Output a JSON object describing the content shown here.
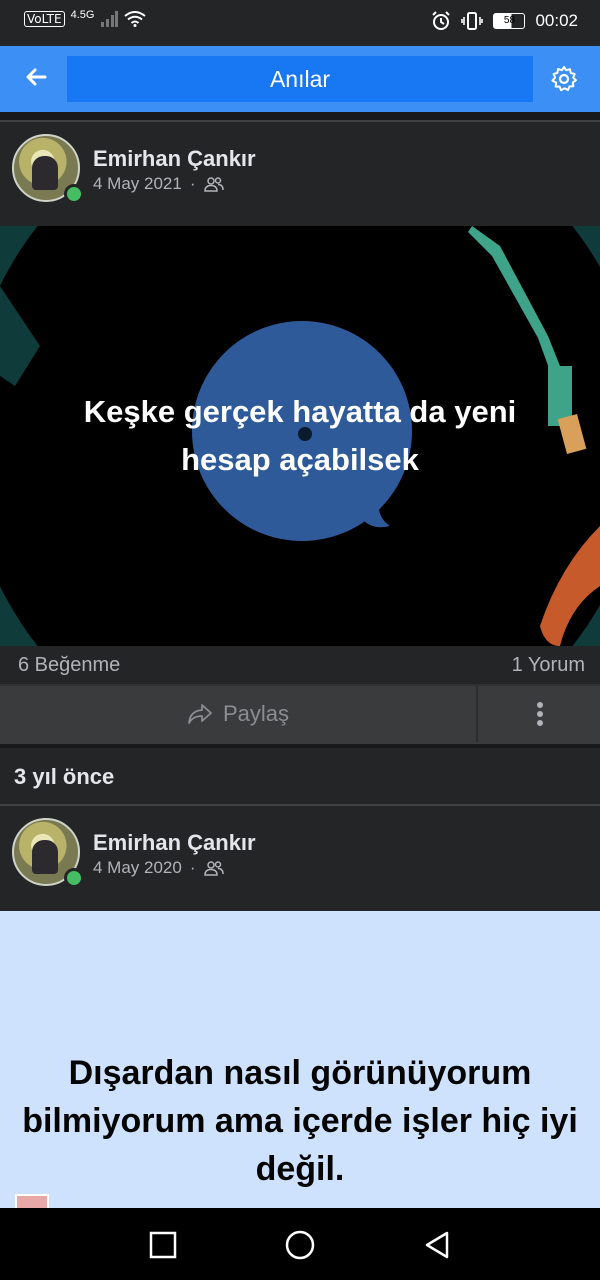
{
  "status_bar": {
    "volte": "VoLTE",
    "network": "4.5G",
    "battery": "58",
    "time": "00:02"
  },
  "app_bar": {
    "back_icon": "arrow-left-icon",
    "title": "Anılar",
    "settings_icon": "gear-icon"
  },
  "posts": [
    {
      "author": "Emirhan Çankır",
      "date": "4 May 2021",
      "separator": "·",
      "audience_icon": "friends-icon",
      "image_text": "Keşke gerçek hayatta da yeni hesap açabilsek",
      "image_text_line1": "Keşke gerçek hayatta da yeni",
      "image_text_line2": "hesap açabilsek",
      "likes": "6 Beğenme",
      "comments": "1 Yorum",
      "share_label": "Paylaş",
      "share_icon": "share-arrow-icon",
      "more_icon": "more-vertical-icon"
    },
    {
      "author": "Emirhan Çankır",
      "date": "4 May 2020",
      "separator": "·",
      "audience_icon": "friends-icon",
      "text_line1": "Dışardan nasıl görünüyorum",
      "text_line2": "bilmiyorum ama içerde işler hiç iyi",
      "text_line3": "değil."
    }
  ],
  "section": {
    "title": "3 yıl önce"
  },
  "colors": {
    "accent": "#1877f2",
    "app_bar": "#3b8ff5",
    "background": "#18191a",
    "card": "#242526",
    "online": "#45bd62",
    "text_post_bg": "#cfe2fd"
  }
}
